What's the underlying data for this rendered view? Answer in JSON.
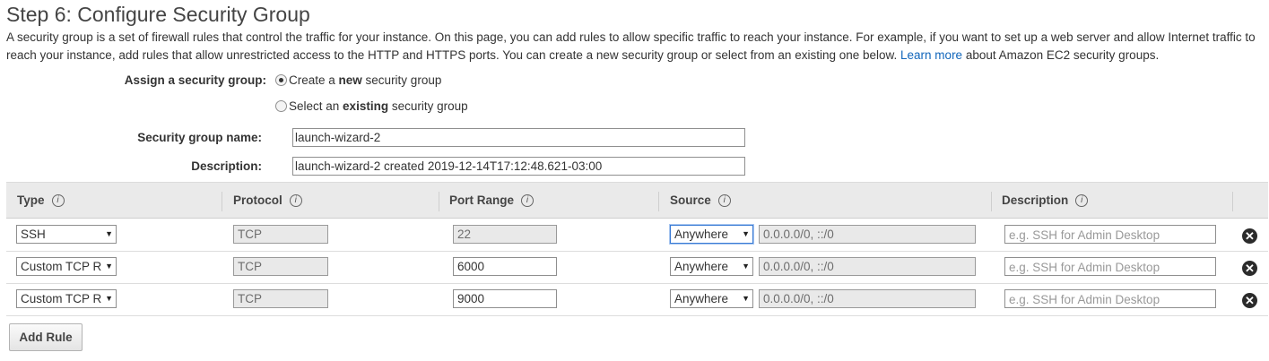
{
  "page": {
    "title": "Step 6: Configure Security Group",
    "intro_before_link": "A security group is a set of firewall rules that control the traffic for your instance. On this page, you can add rules to allow specific traffic to reach your instance. For example, if you want to set up a web server and allow Internet traffic to reach your instance, add rules that allow unrestricted access to the HTTP and HTTPS ports. You can create a new security group or select from an existing one below.",
    "learn_more": "Learn more",
    "intro_after_link": "about Amazon EC2 security groups."
  },
  "assign": {
    "label": "Assign a security group:",
    "option_new": {
      "prefix": "Create a ",
      "bold": "new",
      "suffix": " security group",
      "selected": true
    },
    "option_existing": {
      "prefix": "Select an ",
      "bold": "existing",
      "suffix": " security group",
      "selected": false
    }
  },
  "form": {
    "name_label": "Security group name:",
    "name_value": "launch-wizard-2",
    "desc_label": "Description:",
    "desc_value": "launch-wizard-2 created 2019-12-14T17:12:48.621-03:00"
  },
  "table": {
    "headers": {
      "type": "Type",
      "protocol": "Protocol",
      "port_range": "Port Range",
      "source": "Source",
      "description": "Description"
    },
    "info_icon": "i",
    "rows": [
      {
        "type": "SSH",
        "protocol": "TCP",
        "port": "22",
        "port_editable": false,
        "source": "Anywhere",
        "cidr": "0.0.0.0/0, ::/0",
        "description_placeholder": "e.g. SSH for Admin Desktop"
      },
      {
        "type": "Custom TCP R",
        "protocol": "TCP",
        "port": "6000",
        "port_editable": true,
        "source": "Anywhere",
        "cidr": "0.0.0.0/0, ::/0",
        "description_placeholder": "e.g. SSH for Admin Desktop"
      },
      {
        "type": "Custom TCP R",
        "protocol": "TCP",
        "port": "9000",
        "port_editable": true,
        "source": "Anywhere",
        "cidr": "0.0.0.0/0, ::/0",
        "description_placeholder": "e.g. SSH for Admin Desktop"
      }
    ],
    "remove_icon": "✕",
    "select_arrow": "▼"
  },
  "add_rule_label": "Add Rule",
  "colors": {
    "link": "#1166bb",
    "header_bg": "#eaeaea"
  }
}
